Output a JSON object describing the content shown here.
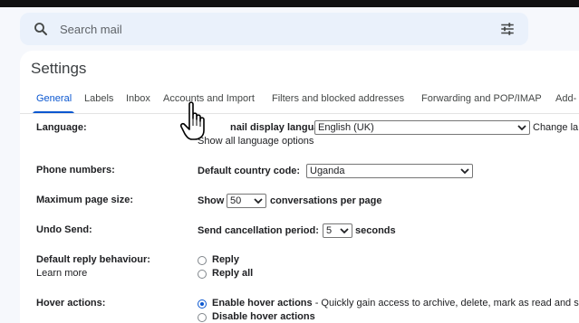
{
  "search": {
    "placeholder": "Search mail"
  },
  "settings": {
    "title": "Settings"
  },
  "tabs": [
    {
      "label": "General"
    },
    {
      "label": "Labels"
    },
    {
      "label": "Inbox"
    },
    {
      "label": "Accounts and Import"
    },
    {
      "label": "Filters and blocked addresses"
    },
    {
      "label": "Forwarding and POP/IMAP"
    },
    {
      "label": "Add-"
    }
  ],
  "rows": {
    "language": {
      "label": "Language:",
      "field_label": "nail display language:",
      "value": "English (UK)",
      "change_link": "Change la",
      "show_all_link": "Show all language options"
    },
    "phone": {
      "label": "Phone numbers:",
      "field_label": "Default country code:",
      "value": "Uganda"
    },
    "page_size": {
      "label": "Maximum page size:",
      "prefix": "Show",
      "value": "50",
      "suffix": "conversations per page"
    },
    "undo_send": {
      "label": "Undo Send:",
      "prefix": "Send cancellation period:",
      "value": "5",
      "suffix": "seconds"
    },
    "reply": {
      "label": "Default reply behaviour:",
      "learn_more": "Learn more",
      "options": [
        "Reply",
        "Reply all"
      ]
    },
    "hover": {
      "label": "Hover actions:",
      "option1_bold": "Enable hover actions",
      "option1_rest": " - Quickly gain access to archive, delete, mark as read and s",
      "option2_bold": "Disable hover actions"
    }
  },
  "colors": {
    "accent": "#0b57d0",
    "background": "#f6f8fc",
    "search_bg": "#eaf1fb"
  },
  "icons": [
    "search-icon",
    "tune-icon",
    "hand-pointer-cursor-icon",
    "chevron-down-icon"
  ]
}
